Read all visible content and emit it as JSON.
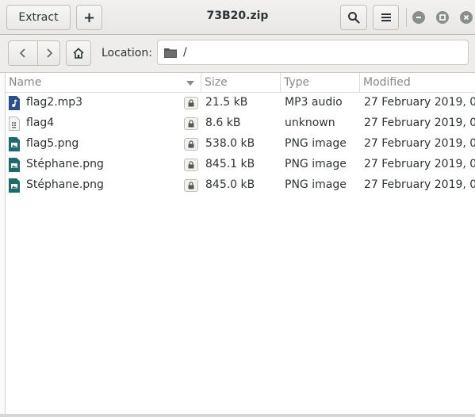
{
  "window": {
    "title": "73B20.zip"
  },
  "header": {
    "extract_label": "Extract",
    "add_label": "+"
  },
  "toolbar": {
    "location_label": "Location:",
    "location_value": "/"
  },
  "columns": {
    "name": "Name",
    "size": "Size",
    "type": "Type",
    "modified": "Modified"
  },
  "files": [
    {
      "name": "flag2.mp3",
      "size": "21.5 kB",
      "type": "MP3 audio",
      "modified": "27 February 2019, 0…",
      "icon": "audio-file-icon"
    },
    {
      "name": "flag4",
      "size": "8.6 kB",
      "type": "unknown",
      "modified": "27 February 2019, 0…",
      "icon": "unknown-file-icon"
    },
    {
      "name": "flag5.png",
      "size": "538.0 kB",
      "type": "PNG image",
      "modified": "27 February 2019, 0…",
      "icon": "image-file-icon"
    },
    {
      "name": "Stéphane.png",
      "size": "845.1 kB",
      "type": "PNG image",
      "modified": "27 February 2019, 0…",
      "icon": "image-file-icon"
    },
    {
      "name": "Stéphane.png",
      "size": "845.0 kB",
      "type": "PNG image",
      "modified": "27 February 2019, 0…",
      "icon": "image-file-icon"
    }
  ],
  "colors": {
    "image_icon": "#1f6b6b",
    "audio_icon": "#2b4f8a",
    "window_button": "#8b8e8f"
  }
}
